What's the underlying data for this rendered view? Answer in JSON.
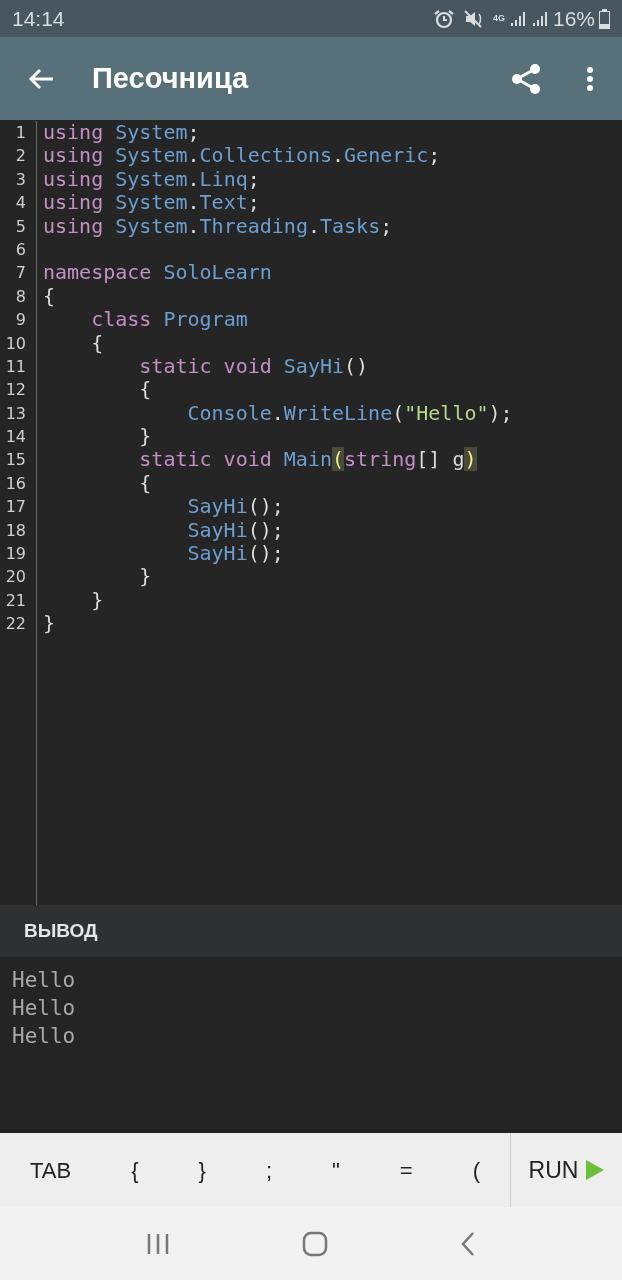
{
  "status_bar": {
    "time": "14:14",
    "battery": "16%",
    "network": "4G"
  },
  "app_bar": {
    "title": "Песочница"
  },
  "editor": {
    "lines": [
      {
        "number": "1",
        "tokens": [
          {
            "t": "using ",
            "kind": "keyword"
          },
          {
            "t": "System",
            "kind": "type"
          },
          {
            "t": ";",
            "kind": "plain"
          }
        ]
      },
      {
        "number": "2",
        "tokens": [
          {
            "t": "using ",
            "kind": "keyword"
          },
          {
            "t": "System",
            "kind": "type"
          },
          {
            "t": ".",
            "kind": "plain"
          },
          {
            "t": "Collections",
            "kind": "type"
          },
          {
            "t": ".",
            "kind": "plain"
          },
          {
            "t": "Generic",
            "kind": "type"
          },
          {
            "t": ";",
            "kind": "plain"
          }
        ]
      },
      {
        "number": "3",
        "tokens": [
          {
            "t": "using ",
            "kind": "keyword"
          },
          {
            "t": "System",
            "kind": "type"
          },
          {
            "t": ".",
            "kind": "plain"
          },
          {
            "t": "Linq",
            "kind": "type"
          },
          {
            "t": ";",
            "kind": "plain"
          }
        ]
      },
      {
        "number": "4",
        "tokens": [
          {
            "t": "using ",
            "kind": "keyword"
          },
          {
            "t": "System",
            "kind": "type"
          },
          {
            "t": ".",
            "kind": "plain"
          },
          {
            "t": "Text",
            "kind": "type"
          },
          {
            "t": ";",
            "kind": "plain"
          }
        ]
      },
      {
        "number": "5",
        "tokens": [
          {
            "t": "using ",
            "kind": "keyword"
          },
          {
            "t": "System",
            "kind": "type"
          },
          {
            "t": ".",
            "kind": "plain"
          },
          {
            "t": "Threading",
            "kind": "type"
          },
          {
            "t": ".",
            "kind": "plain"
          },
          {
            "t": "Tasks",
            "kind": "type"
          },
          {
            "t": ";",
            "kind": "plain"
          }
        ]
      },
      {
        "number": "6"
      },
      {
        "number": "7",
        "tokens": [
          {
            "t": "namespace ",
            "kind": "keyword"
          },
          {
            "t": "SoloLearn",
            "kind": "type"
          }
        ]
      },
      {
        "number": "8",
        "tokens": [
          {
            "t": "{",
            "kind": "plain"
          }
        ]
      },
      {
        "number": "9",
        "tokens": [
          {
            "t": "    class ",
            "kind": "keyword"
          },
          {
            "t": "Program",
            "kind": "type"
          }
        ]
      },
      {
        "number": "10",
        "tokens": [
          {
            "t": "    {",
            "kind": "plain"
          }
        ]
      },
      {
        "number": "11",
        "tokens": [
          {
            "t": "        static void ",
            "kind": "keyword"
          },
          {
            "t": "SayHi",
            "kind": "type"
          },
          {
            "t": "()",
            "kind": "plain"
          }
        ]
      },
      {
        "number": "12",
        "tokens": [
          {
            "t": "        {",
            "kind": "plain"
          }
        ]
      },
      {
        "number": "13",
        "tokens": [
          {
            "t": "            Console",
            "kind": "type"
          },
          {
            "t": ".",
            "kind": "plain"
          },
          {
            "t": "WriteLine",
            "kind": "type"
          },
          {
            "t": "(",
            "kind": "plain"
          },
          {
            "t": "\"Hello\"",
            "kind": "string"
          },
          {
            "t": ");",
            "kind": "plain"
          }
        ]
      },
      {
        "number": "14",
        "tokens": [
          {
            "t": "        }",
            "kind": "plain"
          }
        ]
      },
      {
        "number": "15",
        "tokens": [
          {
            "t": "        static void ",
            "kind": "keyword"
          },
          {
            "t": "Main",
            "kind": "type"
          },
          {
            "t": "(",
            "kind": "match"
          },
          {
            "t": "string",
            "kind": "keyword"
          },
          {
            "t": "[] g",
            "kind": "plain"
          },
          {
            "t": ")",
            "kind": "match"
          }
        ]
      },
      {
        "number": "16",
        "tokens": [
          {
            "t": "        {",
            "kind": "plain"
          }
        ]
      },
      {
        "number": "17",
        "tokens": [
          {
            "t": "            SayHi",
            "kind": "type"
          },
          {
            "t": "();",
            "kind": "plain"
          }
        ]
      },
      {
        "number": "18",
        "tokens": [
          {
            "t": "            SayHi",
            "kind": "type"
          },
          {
            "t": "();",
            "kind": "plain"
          }
        ]
      },
      {
        "number": "19",
        "tokens": [
          {
            "t": "            SayHi",
            "kind": "type"
          },
          {
            "t": "();",
            "kind": "plain"
          }
        ]
      },
      {
        "number": "20",
        "tokens": [
          {
            "t": "        }",
            "kind": "plain"
          }
        ]
      },
      {
        "number": "21",
        "tokens": [
          {
            "t": "    }",
            "kind": "plain"
          }
        ]
      },
      {
        "number": "22",
        "tokens": [
          {
            "t": "}",
            "kind": "plain"
          }
        ]
      }
    ]
  },
  "output": {
    "title": "ВЫВОД",
    "lines": [
      "Hello",
      "Hello",
      "Hello"
    ]
  },
  "key_bar": {
    "keys": [
      "TAB",
      "{",
      "}",
      ";",
      "\"",
      "=",
      "("
    ],
    "run": "RUN"
  }
}
